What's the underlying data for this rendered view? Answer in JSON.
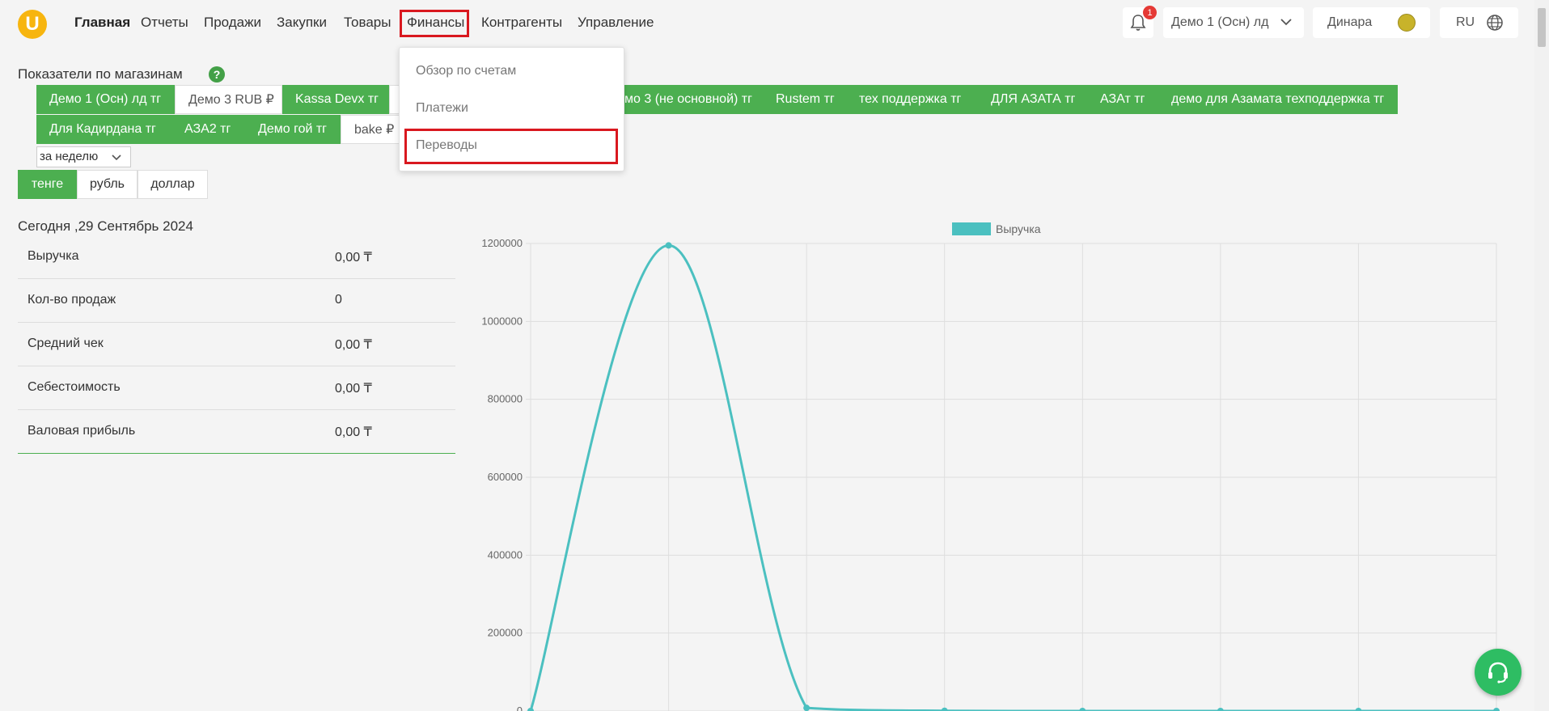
{
  "header": {
    "logo": "U",
    "nav": [
      {
        "label": "Главная",
        "active": true
      },
      {
        "label": "Отчеты"
      },
      {
        "label": "Продажи"
      },
      {
        "label": "Закупки"
      },
      {
        "label": "Товары"
      },
      {
        "label": "Финансы",
        "highlighted": true
      },
      {
        "label": "Контрагенты"
      },
      {
        "label": "Управление"
      }
    ],
    "notification_count": "1",
    "store_selected": "Демо 1 (Осн) лд",
    "user_name": "Динара",
    "language": "RU"
  },
  "dropdown": {
    "items": [
      "Обзор по счетам",
      "Платежи",
      "Переводы"
    ],
    "highlighted_item": "Переводы"
  },
  "section_title": "Показатели по магазинам",
  "store_tabs": [
    {
      "label": "Демо 1 (Осн) лд тг",
      "style": "green"
    },
    {
      "label": "Демо 3 RUB ₽",
      "style": "white"
    },
    {
      "label": "Kassa Devx тг",
      "style": "green"
    },
    {
      "label": "мо 3 (не основной) тг",
      "style": "green"
    },
    {
      "label": "Rustem тг",
      "style": "green"
    },
    {
      "label": "тех поддержка тг",
      "style": "green"
    },
    {
      "label": "ДЛЯ АЗАТА тг",
      "style": "green"
    },
    {
      "label": "АЗАт тг",
      "style": "green"
    },
    {
      "label": "демо для Азамата техподдержка тг",
      "style": "green"
    },
    {
      "label": "Для Кадирдана тг",
      "style": "green"
    },
    {
      "label": "АЗА2 тг",
      "style": "green"
    },
    {
      "label": "Демо гой тг",
      "style": "green"
    },
    {
      "label": "bake ₽",
      "style": "white"
    }
  ],
  "period": "за неделю",
  "currencies": [
    {
      "label": "тенге",
      "active": true
    },
    {
      "label": "рубль"
    },
    {
      "label": "доллар"
    }
  ],
  "today_title": "Сегодня ,29 Сентябрь 2024",
  "stats": [
    {
      "label": "Выручка",
      "value": "0,00 ₸"
    },
    {
      "label": "Кол-во продаж",
      "value": "0"
    },
    {
      "label": "Средний чек",
      "value": "0,00 ₸"
    },
    {
      "label": "Себестоимость",
      "value": "0,00 ₸"
    },
    {
      "label": "Валовая прибыль",
      "value": "0,00 ₸"
    }
  ],
  "chart_data": {
    "type": "line",
    "series": [
      {
        "name": "Выручка",
        "color": "#4bc0c0",
        "values": [
          0,
          1195000,
          8000,
          500,
          0,
          0,
          0,
          0
        ]
      }
    ],
    "x": [
      0,
      1,
      2,
      3,
      4,
      5,
      6,
      7
    ],
    "ylim": [
      0,
      1200000
    ],
    "yticks": [
      0,
      200000,
      400000,
      600000,
      800000,
      1000000,
      1200000
    ],
    "ytick_labels": [
      "0",
      "200000",
      "400000",
      "600000",
      "800000",
      "1000000",
      "1200000"
    ],
    "grid": true,
    "legend": "top-center"
  },
  "colors": {
    "accent": "#4caf50",
    "highlight": "#d9181f",
    "logo": "#f7b50f",
    "support": "#2ebd63"
  }
}
